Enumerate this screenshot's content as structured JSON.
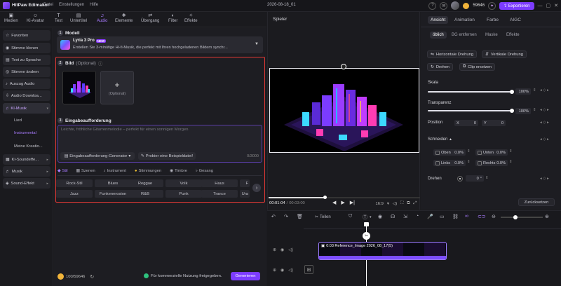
{
  "titlebar": {
    "app_name": "HitPaw Edimakor",
    "menus": [
      "Datei",
      "Einstellungen",
      "Hilfe"
    ],
    "project_name": "2026-08-18_01",
    "credits": "59646",
    "export_label": "Exportieren"
  },
  "tools": [
    {
      "label": "Medien",
      "icon": "media-icon"
    },
    {
      "label": "KI-Avatar",
      "icon": "ai-avatar-icon"
    },
    {
      "label": "Text",
      "icon": "text-icon"
    },
    {
      "label": "Untertitel",
      "icon": "subtitle-icon"
    },
    {
      "label": "Audio",
      "icon": "audio-icon"
    },
    {
      "label": "Elemente",
      "icon": "elements-icon"
    },
    {
      "label": "Übergang",
      "icon": "transition-icon"
    },
    {
      "label": "Filter",
      "icon": "filter-icon"
    },
    {
      "label": "Effekte",
      "icon": "effects-icon"
    }
  ],
  "sidebar": {
    "items": [
      {
        "label": "Favoriten",
        "icon": "star-icon"
      },
      {
        "label": "Stimme klonen",
        "icon": "voice-clone-icon"
      },
      {
        "label": "Text zu Sprache",
        "icon": "tts-icon"
      },
      {
        "label": "Stimme ändern",
        "icon": "voice-change-icon"
      },
      {
        "label": "Auszug Audio",
        "icon": "extract-audio-icon"
      },
      {
        "label": "Audio Downloa...",
        "icon": "download-icon"
      },
      {
        "label": "KI-Musik",
        "icon": "music-icon"
      }
    ],
    "subitems": [
      "Lied",
      "Instrumental",
      "Meine Kreatio..."
    ],
    "more_items": [
      {
        "label": "KI-Soundeffe...",
        "icon": "sfx-icon"
      },
      {
        "label": "Musik",
        "icon": "music-note-icon"
      },
      {
        "label": "Sound-Effekt",
        "icon": "sound-icon"
      }
    ]
  },
  "panel": {
    "model_heading": "Modell",
    "model_name": "Lyria 3 Pro",
    "model_badge": "NEW",
    "model_desc": "Erstellen Sie 3-minütige Hi-fi-Musik, die perfekt mit Ihren hochgeladenen Bildern synchr...",
    "image_heading": "Bild",
    "image_optional": "(Optional)",
    "image_add_label": "(Optional)",
    "prompt_heading": "Eingabeaufforderung",
    "prompt_placeholder": "Leichte, fröhliche Gitarrenmelodie – perfekt für einen sonnigen Morgen",
    "prompt_generator": "Eingabeaufforderung-Generator",
    "sample_file": "Probier eine Beispieldatei!",
    "char_count": "0/3000",
    "tabs": [
      "Stil",
      "Szenen",
      "Instrument",
      "Stimmungen",
      "Timbre",
      "Gesang"
    ],
    "genres": [
      "Rock-Stil",
      "Blues",
      "Reggae",
      "Volk",
      "Haus",
      "F",
      "Jazz",
      "Funkenerosion",
      "R&B",
      "Punk",
      "Trance",
      "Ura"
    ],
    "credits": "100/59646",
    "commercial_note": "Für kommerzielle Nutzung freigegeben.",
    "generate_label": "Generieren"
  },
  "player": {
    "title": "Spieler",
    "time_current": "00:01:04",
    "time_total": "00:03:00",
    "aspect": "16:9"
  },
  "right_panel": {
    "tabs": [
      "Ansicht",
      "Animation",
      "Farbe",
      "AIGC"
    ],
    "subtabs": [
      "öblich",
      "BG entfernen",
      "Maske",
      "Effekte"
    ],
    "flip_h": "Horizontale Drehung",
    "flip_v": "Vertikale Drehung",
    "rotate": "Drehen",
    "replace_clip": "Clip ersetzen",
    "scale_label": "Skala",
    "scale_value": "100%",
    "scale_level": 1.0,
    "transparency_label": "Transparenz",
    "transparency_value": "100%",
    "transparency_level": 1.0,
    "position_label": "Position",
    "pos_x_label": "X",
    "pos_x": "0",
    "pos_y_label": "Y",
    "pos_y": "0",
    "crop_label": "Schneiden",
    "crop_fields": [
      {
        "label": "Oben",
        "value": "0.0%"
      },
      {
        "label": "Unten",
        "value": "0.0%"
      },
      {
        "label": "Links",
        "value": "0.0%"
      },
      {
        "label": "Rechts",
        "value": "0.0%"
      }
    ],
    "rotate_label": "Drehen",
    "rotate_value": "0",
    "rotate_unit": "°",
    "reset_label": "Zurücksetzen"
  },
  "timeline": {
    "split_label": "Teilen",
    "clip_name": "0:03 Reference_Image 2026_08_17(5)"
  },
  "colors": {
    "accent": "#7c3cff",
    "highlight_border": "#e53935"
  }
}
